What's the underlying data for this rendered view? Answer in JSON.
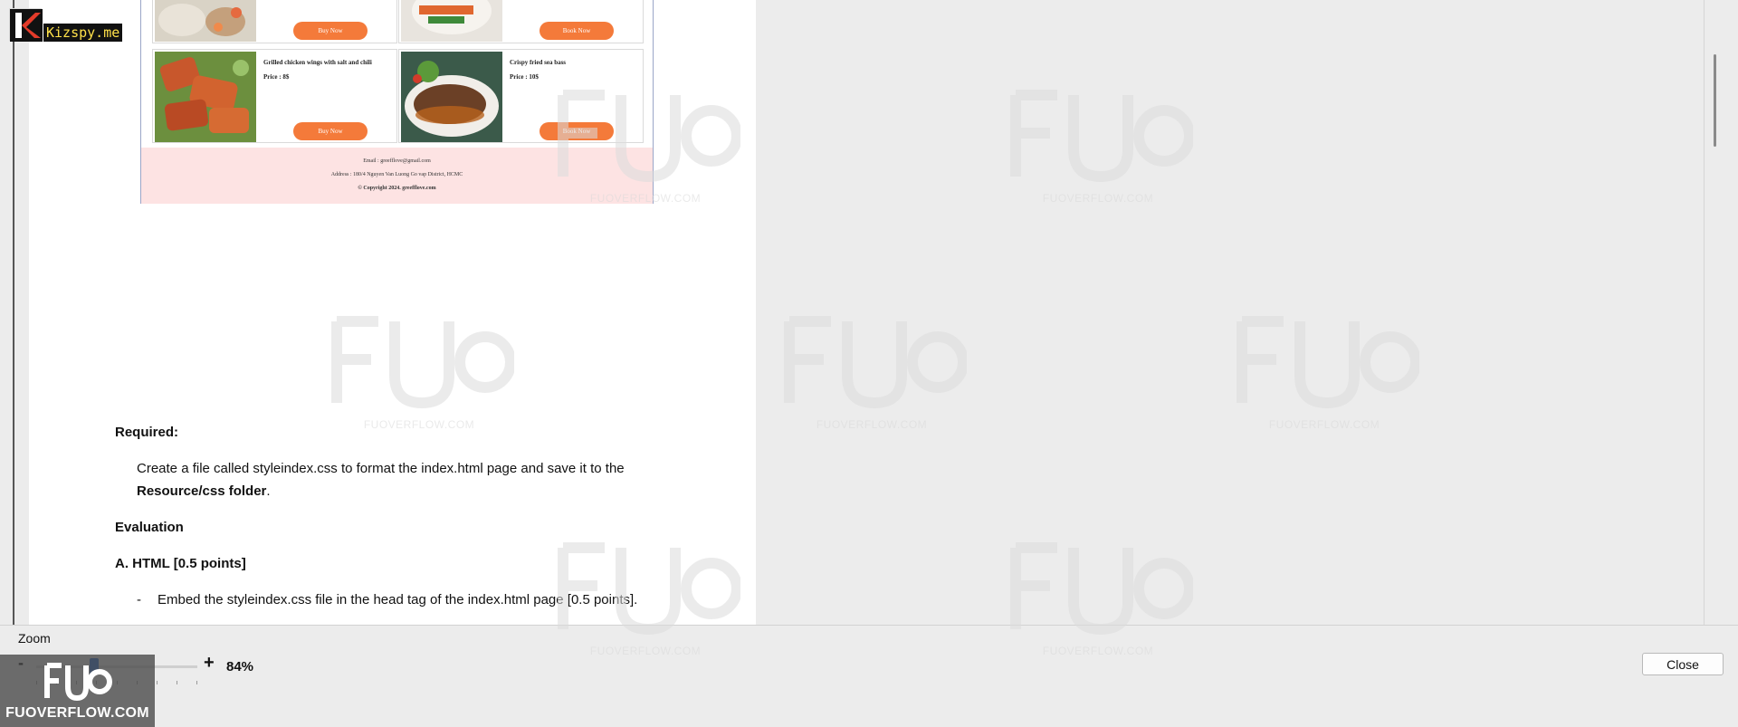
{
  "badge": {
    "site": "Kizspy.me"
  },
  "embedded_page": {
    "top_row": [
      {
        "button": "Buy Now"
      },
      {
        "button": "Book Now"
      }
    ],
    "cards": [
      {
        "name": "Grilled chicken wings with salt and chili",
        "price": "Price : 8$",
        "button": "Buy Now"
      },
      {
        "name": "Crispy fried sea bass",
        "price": "Price : 10$",
        "button": "Book Now"
      }
    ],
    "footer": {
      "email": "Email : greefflove@gmail.com",
      "address": "Address : 180/4 Nguyen Van Luong Go vap District, HCMC",
      "copyright": "© Copyright 2024. greefflove.com"
    }
  },
  "document": {
    "required_heading": "Required:",
    "required_text_1": "Create a file called styleindex.css to format the index.html page and save it to the",
    "required_text_2_bold": "Resource/css folder",
    "required_text_2_end": ".",
    "evaluation_heading": "Evaluation",
    "section_a_heading": "A. HTML  [0.5 points]",
    "bullet_dash": "-",
    "bullet_1": "Embed the styleindex.css file in the head tag of the index.html page [0.5 points]."
  },
  "watermark": {
    "logo": "FUO",
    "text": "FUOVERFLOW.COM"
  },
  "zoom": {
    "label": "Zoom",
    "minus": "-",
    "plus": "+",
    "value": "84%",
    "level_percent": 84
  },
  "buttons": {
    "close": "Close"
  },
  "brand_box": {
    "logo": "FUO",
    "text": "FUOVERFLOW.COM"
  },
  "colors": {
    "accent_orange": "#f47a3a",
    "footer_pink": "#fde3e3",
    "slider_blue": "#2b6fd1"
  }
}
